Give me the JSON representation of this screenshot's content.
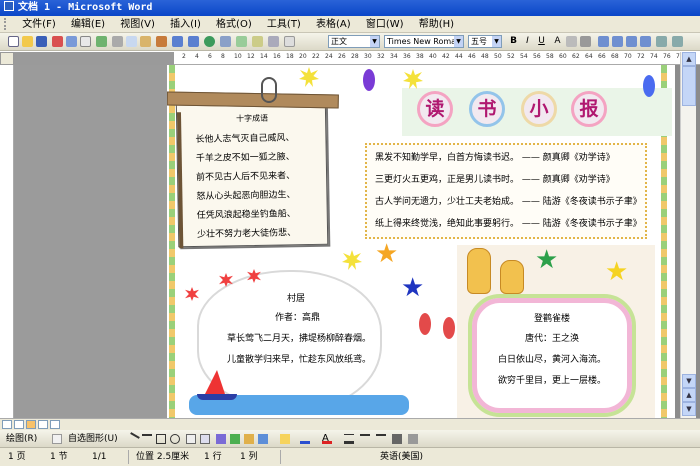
{
  "window": {
    "title": "文档 1 - Microsoft Word"
  },
  "menu": [
    "文件(F)",
    "编辑(E)",
    "视图(V)",
    "插入(I)",
    "格式(O)",
    "工具(T)",
    "表格(A)",
    "窗口(W)",
    "帮助(H)"
  ],
  "format_bar": {
    "style": "正文",
    "font": "Times New Roman",
    "size": "五号"
  },
  "ruler": {
    "numbers": [
      "2",
      "4",
      "6",
      "8",
      "10",
      "12",
      "14",
      "16",
      "18",
      "20",
      "22",
      "24",
      "26",
      "28",
      "30",
      "32",
      "34",
      "36",
      "38",
      "40",
      "42",
      "44",
      "46",
      "48",
      "50",
      "52",
      "54",
      "56",
      "58",
      "60",
      "62",
      "64",
      "66",
      "68",
      "70",
      "72",
      "74",
      "76",
      "78"
    ]
  },
  "note": {
    "title": "十字成语",
    "lines": [
      "长他人志气灭自己威风、",
      "千羊之皮不如一狐之腋、",
      "前不见古人后不见来者、",
      "怒从心头起恶向胆边生、",
      "任凭风浪起稳坐钓鱼船、",
      "少壮不努力老大徒伤悲、"
    ]
  },
  "header": {
    "chars": [
      "读",
      "书",
      "小",
      "报"
    ]
  },
  "quotes": [
    {
      "text": "黑发不知勤学早，白首方悔读书迟。",
      "author": "—— 颜真卿《劝学诗》"
    },
    {
      "text": "三更灯火五更鸡，正是男儿读书时。",
      "author": "—— 颜真卿《劝学诗》"
    },
    {
      "text": "古人学问无遗力，少壮工夫老始成。",
      "author": "—— 陆游《冬夜读书示子聿》"
    },
    {
      "text": "纸上得来终觉浅，绝知此事要躬行。",
      "author": "—— 陆游《冬夜读书示子聿》"
    }
  ],
  "poem_left": {
    "title": "村居",
    "author": "作者：高鼎",
    "lines": [
      "草长莺飞二月天，拂堤杨柳醉春烟。",
      "儿童散学归来早，忙趁东风放纸鸢。"
    ]
  },
  "poem_right": {
    "title": "登鹳雀楼",
    "author": "唐代：王之涣",
    "lines": [
      "白日依山尽，黄河入海流。",
      "欲穷千里目，更上一层楼。"
    ]
  },
  "draw_bar": {
    "draw": "绘图(R)",
    "autoshapes": "自选图形(U)"
  },
  "status": {
    "page": "1 页",
    "section": "1 节",
    "pos": "1/1",
    "at": "位置 2.5厘米",
    "line": "1 行",
    "col": "1 列",
    "lang": "英语(美国)"
  },
  "colors": {
    "title_bar": "#0a46c8",
    "page_accent": "#b01870",
    "quote_border": "#e2b548"
  }
}
